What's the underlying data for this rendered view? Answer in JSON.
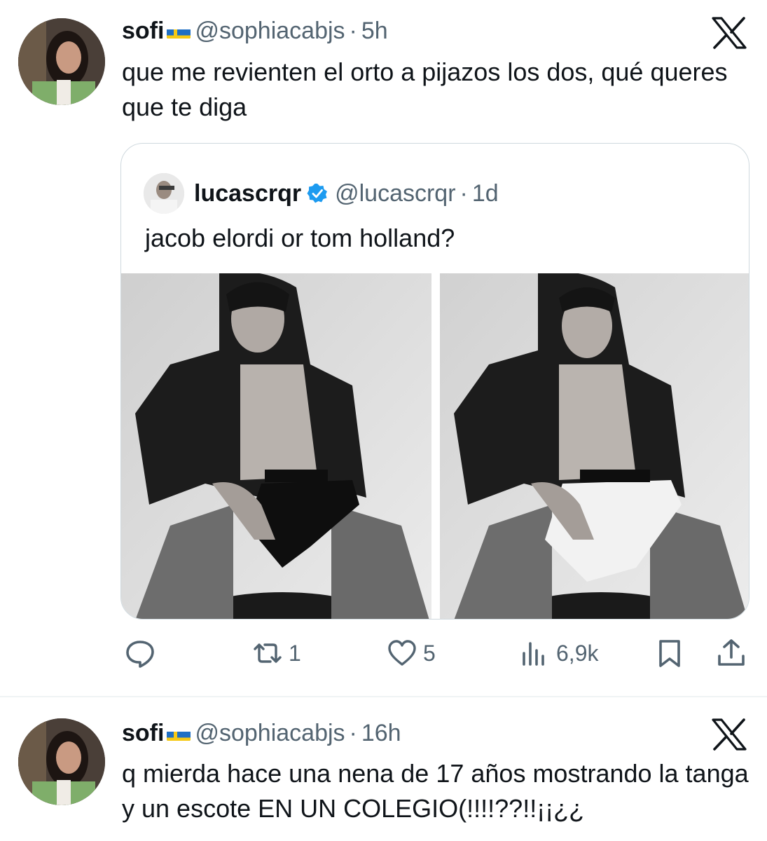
{
  "tweets": [
    {
      "display_name": "sofi",
      "flag": "sweden-flag",
      "handle": "@sophiacabjs",
      "separator": "·",
      "time": "5h",
      "text": "que me revienten el orto a pijazos los dos, qué queres que te diga"
    },
    {
      "display_name": "sofi",
      "flag": "sweden-flag",
      "handle": "@sophiacabjs",
      "separator": "·",
      "time": "16h",
      "text": "q mierda hace una nena de 17 años mostrando la tanga y un escote EN UN COLEGIO(!!!!??!!¡¡¿¿"
    }
  ],
  "quoted": {
    "display_name": "lucascrqr",
    "verified": true,
    "handle": "@lucascrqr",
    "separator": "·",
    "time": "1d",
    "text": "jacob elordi or tom holland?"
  },
  "actions": {
    "reply_icon": "reply-icon",
    "retweet_count": "1",
    "like_count": "5",
    "views_count": "6,9k",
    "bookmark_icon": "bookmark-icon",
    "share_icon": "share-icon"
  },
  "colors": {
    "text_primary": "#0f1419",
    "text_secondary": "#536471",
    "verified_blue": "#1d9bf0",
    "border": "#cfd9de"
  }
}
